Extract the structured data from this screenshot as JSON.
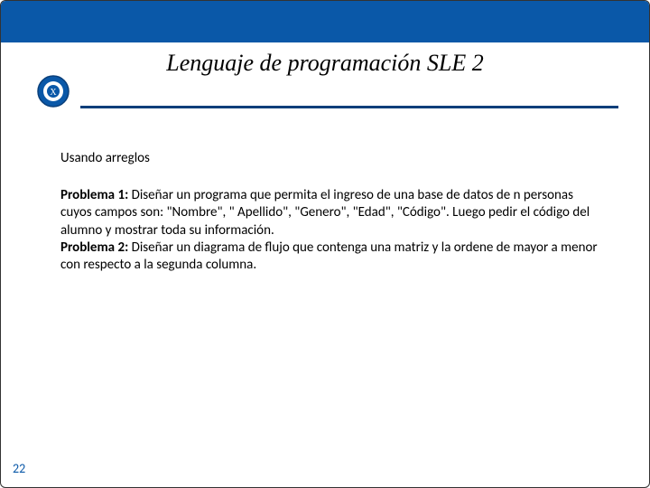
{
  "title": "Lenguaje de programación SLE 2",
  "subheading": "Usando arreglos",
  "problem1_label": "Problema 1:",
  "problem1_text": " Diseñar un programa que permita el ingreso de una base de datos de n personas cuyos campos son: \"Nombre\", \" Apellido\", \"Genero\", \"Edad\", \"Código\". Luego pedir el código del alumno y mostrar toda su información.",
  "problem2_label": " Problema 2:",
  "problem2_text": " Diseñar un diagrama de flujo que contenga una matriz y la ordene de mayor a menor con respecto a la segunda columna.",
  "page_number": "22",
  "colors": {
    "brand_blue": "#0a58a8",
    "dark_blue": "#0a3f7a"
  }
}
